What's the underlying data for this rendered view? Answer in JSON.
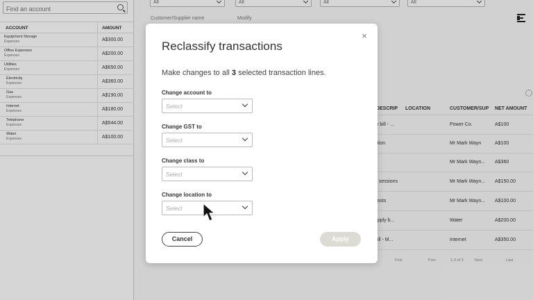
{
  "account_panel": {
    "search_placeholder": "Find an account",
    "col_account": "ACCOUNT",
    "col_amount": "AMOUNT",
    "rows": [
      {
        "name": "Equipment Storage",
        "type": "Expenses",
        "amount": "A$300.00"
      },
      {
        "name": "Office Expenses",
        "type": "Expenses",
        "amount": "A$200.00"
      },
      {
        "name": "Utilities",
        "type": "Expenses",
        "amount": "A$650.00"
      },
      {
        "name": "Electricity",
        "type": "Expenses",
        "amount": "A$360.00"
      },
      {
        "name": "Gas",
        "type": "Expenses",
        "amount": "A$190.00"
      },
      {
        "name": "Internet",
        "type": "Expenses",
        "amount": "A$180.00"
      },
      {
        "name": "Telephone",
        "type": "Expenses",
        "amount": "A$544.00"
      },
      {
        "name": "Water",
        "type": "Expenses",
        "amount": "A$100.00"
      }
    ]
  },
  "filters": {
    "values": [
      "All",
      "All",
      "All",
      "All"
    ],
    "customer_supplier_label": "Customer/Supplier name",
    "modify_label": "Modify"
  },
  "table": {
    "headers": {
      "description": "/DESCRIP",
      "location": "LOCATION",
      "customer": "CUSTOMER/SUP",
      "net_amount": "NET AMOUNT"
    },
    "rows": [
      {
        "description": "ty bill - ...",
        "customer": "Power Co.",
        "net_amount": "A$100"
      },
      {
        "description": "ation",
        "customer": "Mr Mark Wayn",
        "net_amount": "A$100"
      },
      {
        "description": "",
        "customer": "Mr Mark Wayn...",
        "net_amount": "A$360"
      },
      {
        "description": "g sessions",
        "customer": "Mr Mark Wayn...",
        "net_amount": "A$150.00"
      },
      {
        "description": "costs",
        "customer": "Mr Mark Wayn...",
        "net_amount": "A$100.00"
      },
      {
        "description": "upply b...",
        "customer": "Water",
        "net_amount": "A$200.00"
      },
      {
        "description": "bill - M...",
        "customer": "Internet",
        "net_amount": "A$350.00"
      }
    ],
    "pager": {
      "first": "First",
      "prev": "Prev",
      "range": "1-3 of 3",
      "next": "Next",
      "last": "Last"
    }
  },
  "modal": {
    "title": "Reclassify transactions",
    "subtitle_before": "Make changes to all ",
    "subtitle_count": "3",
    "subtitle_after": " selected transaction lines.",
    "fields": [
      {
        "label": "Change account to",
        "placeholder": "Select"
      },
      {
        "label": "Change GST to",
        "placeholder": "Select"
      },
      {
        "label": "Change class to",
        "placeholder": "Select"
      },
      {
        "label": "Change location to",
        "placeholder": "Select"
      }
    ],
    "cancel_label": "Cancel",
    "apply_label": "Apply",
    "close_glyph": "×"
  },
  "colors": {
    "overlay": "#000000",
    "apply_disabled": "#dcdcd4",
    "text_primary": "#333333"
  }
}
